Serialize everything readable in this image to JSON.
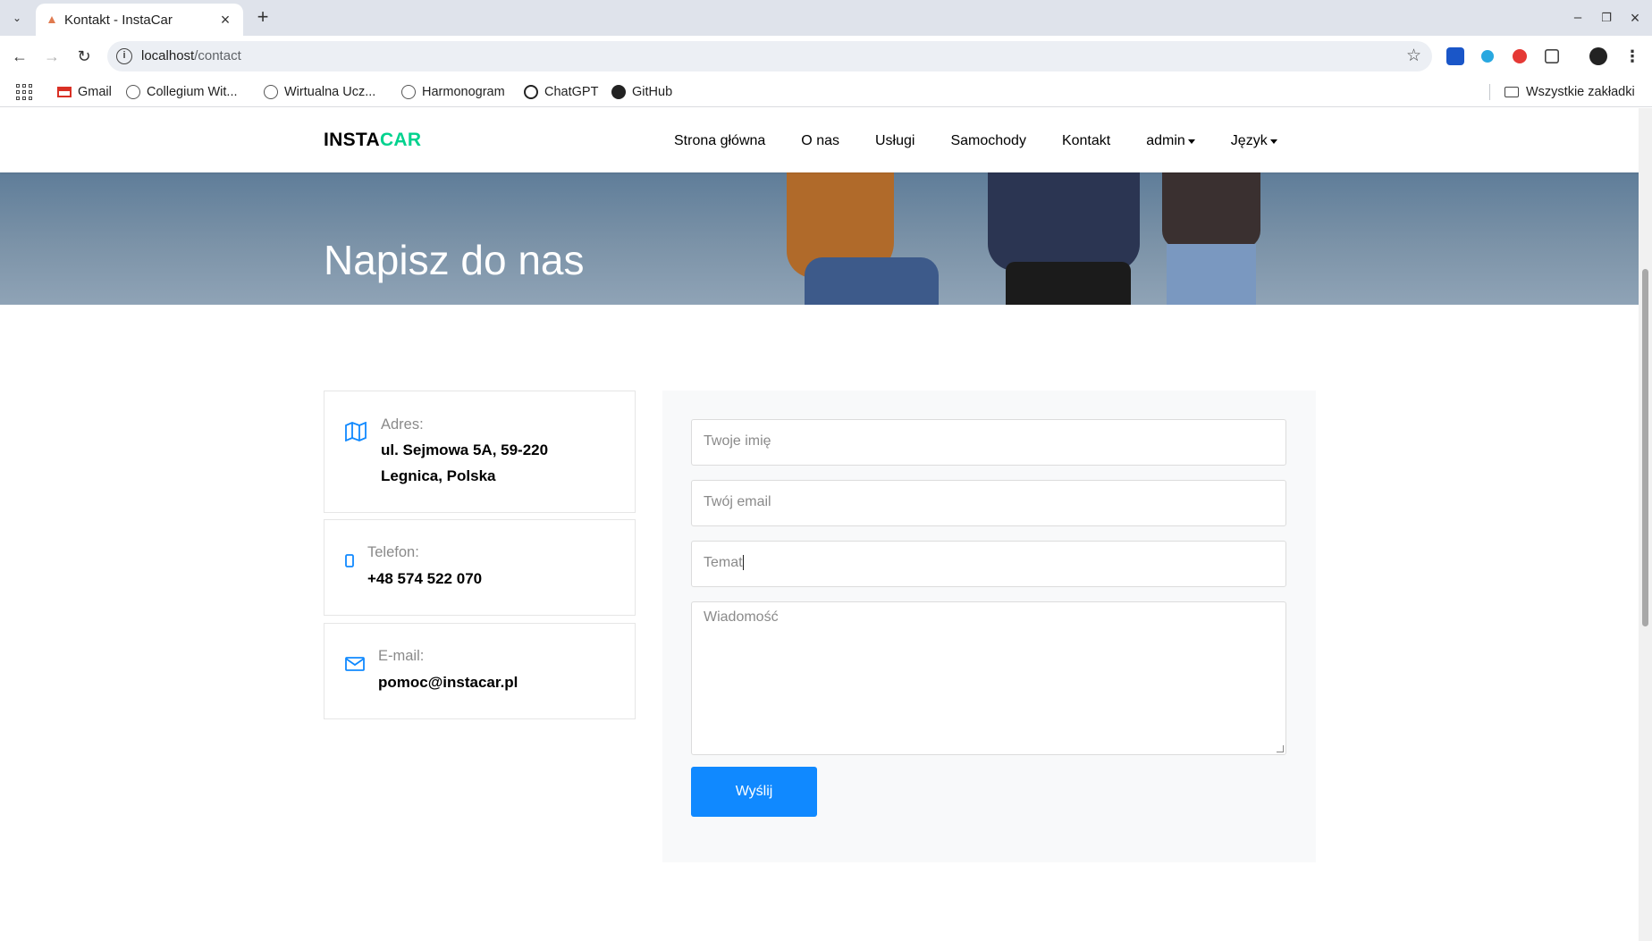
{
  "browser": {
    "tab_title": "Kontakt - InstaCar",
    "url_host": "localhost",
    "url_path": "/contact",
    "bookmarks": [
      "Gmail",
      "Collegium Wit...",
      "Wirtualna Ucz...",
      "Harmonogram",
      "ChatGPT",
      "GitHub"
    ],
    "all_bookmarks": "Wszystkie zakładki"
  },
  "site": {
    "logo_left": "INSTA",
    "logo_right": "CAR",
    "nav": [
      "Strona główna",
      "O nas",
      "Usługi",
      "Samochody",
      "Kontakt",
      "admin",
      "Język"
    ],
    "accent_color": "#01d28e",
    "primary_color": "#1089ff"
  },
  "hero": {
    "title": "Napisz do nas"
  },
  "contact": {
    "address_label": "Adres:",
    "address_line1": "ul. Sejmowa 5A, 59-220",
    "address_line2": "Legnica, Polska",
    "phone_label": "Telefon:",
    "phone_value": "+48 574 522 070",
    "email_label": "E-mail:",
    "email_value": "pomoc@instacar.pl"
  },
  "form": {
    "name_placeholder": "Twoje imię",
    "email_placeholder": "Twój email",
    "subject_placeholder": "Temat",
    "message_placeholder": "Wiadomość",
    "submit_label": "Wyślij"
  }
}
